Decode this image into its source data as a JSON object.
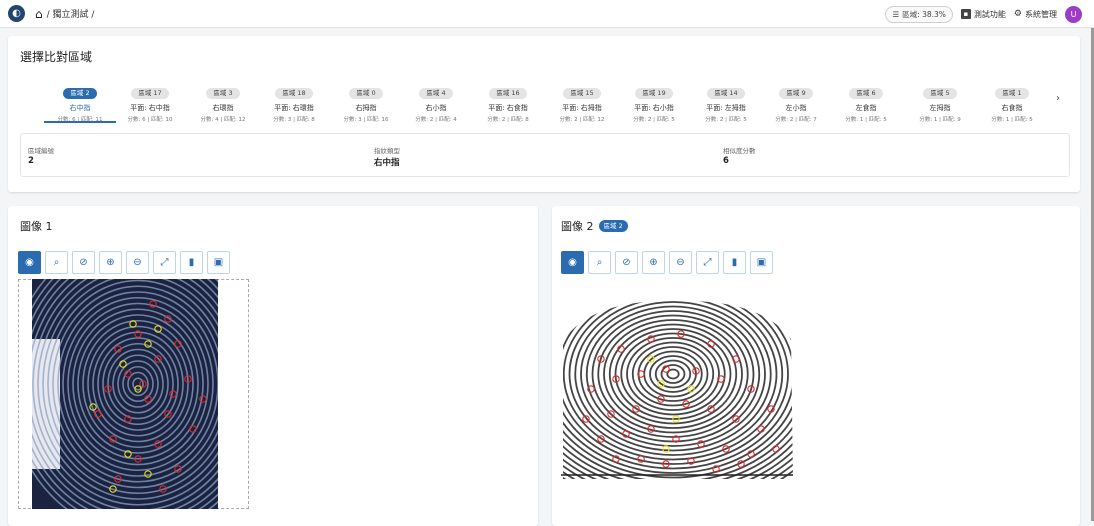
{
  "header": {
    "breadcrumb": "/ 獨立測試 /",
    "chip_text": "區域: 38.3%",
    "test_label": "測試功能",
    "admin_label": "系統管理",
    "avatar_letter": "U"
  },
  "compare": {
    "title": "選擇比對區域",
    "regions": [
      {
        "badge": "區域 2",
        "name": "右中指",
        "score": "分數: 6 | 匹配: 11",
        "active": true
      },
      {
        "badge": "區域 17",
        "name": "平面: 右中指",
        "score": "分數: 6 | 匹配: 10"
      },
      {
        "badge": "區域 3",
        "name": "右環指",
        "score": "分數: 4 | 匹配: 12"
      },
      {
        "badge": "區域 18",
        "name": "平面: 右環指",
        "score": "分數: 3 | 匹配: 8"
      },
      {
        "badge": "區域 0",
        "name": "右拇指",
        "score": "分數: 3 | 匹配: 16"
      },
      {
        "badge": "區域 4",
        "name": "右小指",
        "score": "分數: 2 | 匹配: 4"
      },
      {
        "badge": "區域 16",
        "name": "平面: 右食指",
        "score": "分數: 2 | 匹配: 8"
      },
      {
        "badge": "區域 15",
        "name": "平面: 右拇指",
        "score": "分數: 2 | 匹配: 12"
      },
      {
        "badge": "區域 19",
        "name": "平面: 右小指",
        "score": "分數: 2 | 匹配: 5"
      },
      {
        "badge": "區域 14",
        "name": "平面: 左拇指",
        "score": "分數: 2 | 匹配: 5"
      },
      {
        "badge": "區域 9",
        "name": "左小指",
        "score": "分數: 2 | 匹配: 7"
      },
      {
        "badge": "區域 6",
        "name": "左食指",
        "score": "分數: 1 | 匹配: 5"
      },
      {
        "badge": "區域 5",
        "name": "左拇指",
        "score": "分數: 1 | 匹配: 9"
      },
      {
        "badge": "區域 1",
        "name": "右食指",
        "score": "分數: 1 | 匹配: 5"
      }
    ],
    "info": {
      "region_no_label": "區域編號",
      "region_no": "2",
      "finger_type_label": "指紋類型",
      "finger_type": "右中指",
      "similarity_label": "相似度分數",
      "similarity": "6"
    }
  },
  "images": {
    "image1_title": "圖像 1",
    "image2_title": "圖像 2",
    "image2_tag": "區域 2",
    "tools": [
      "eye-icon",
      "search-reset-icon",
      "hide-icon",
      "zoom-in-icon",
      "zoom-out-icon",
      "fit-screen-icon",
      "delete-icon",
      "save-icon"
    ]
  },
  "colors": {
    "accent": "#2b6cb0",
    "minutia_red": "#e02828",
    "minutia_yellow": "#e8e020",
    "avatar": "#9c3cc8"
  }
}
